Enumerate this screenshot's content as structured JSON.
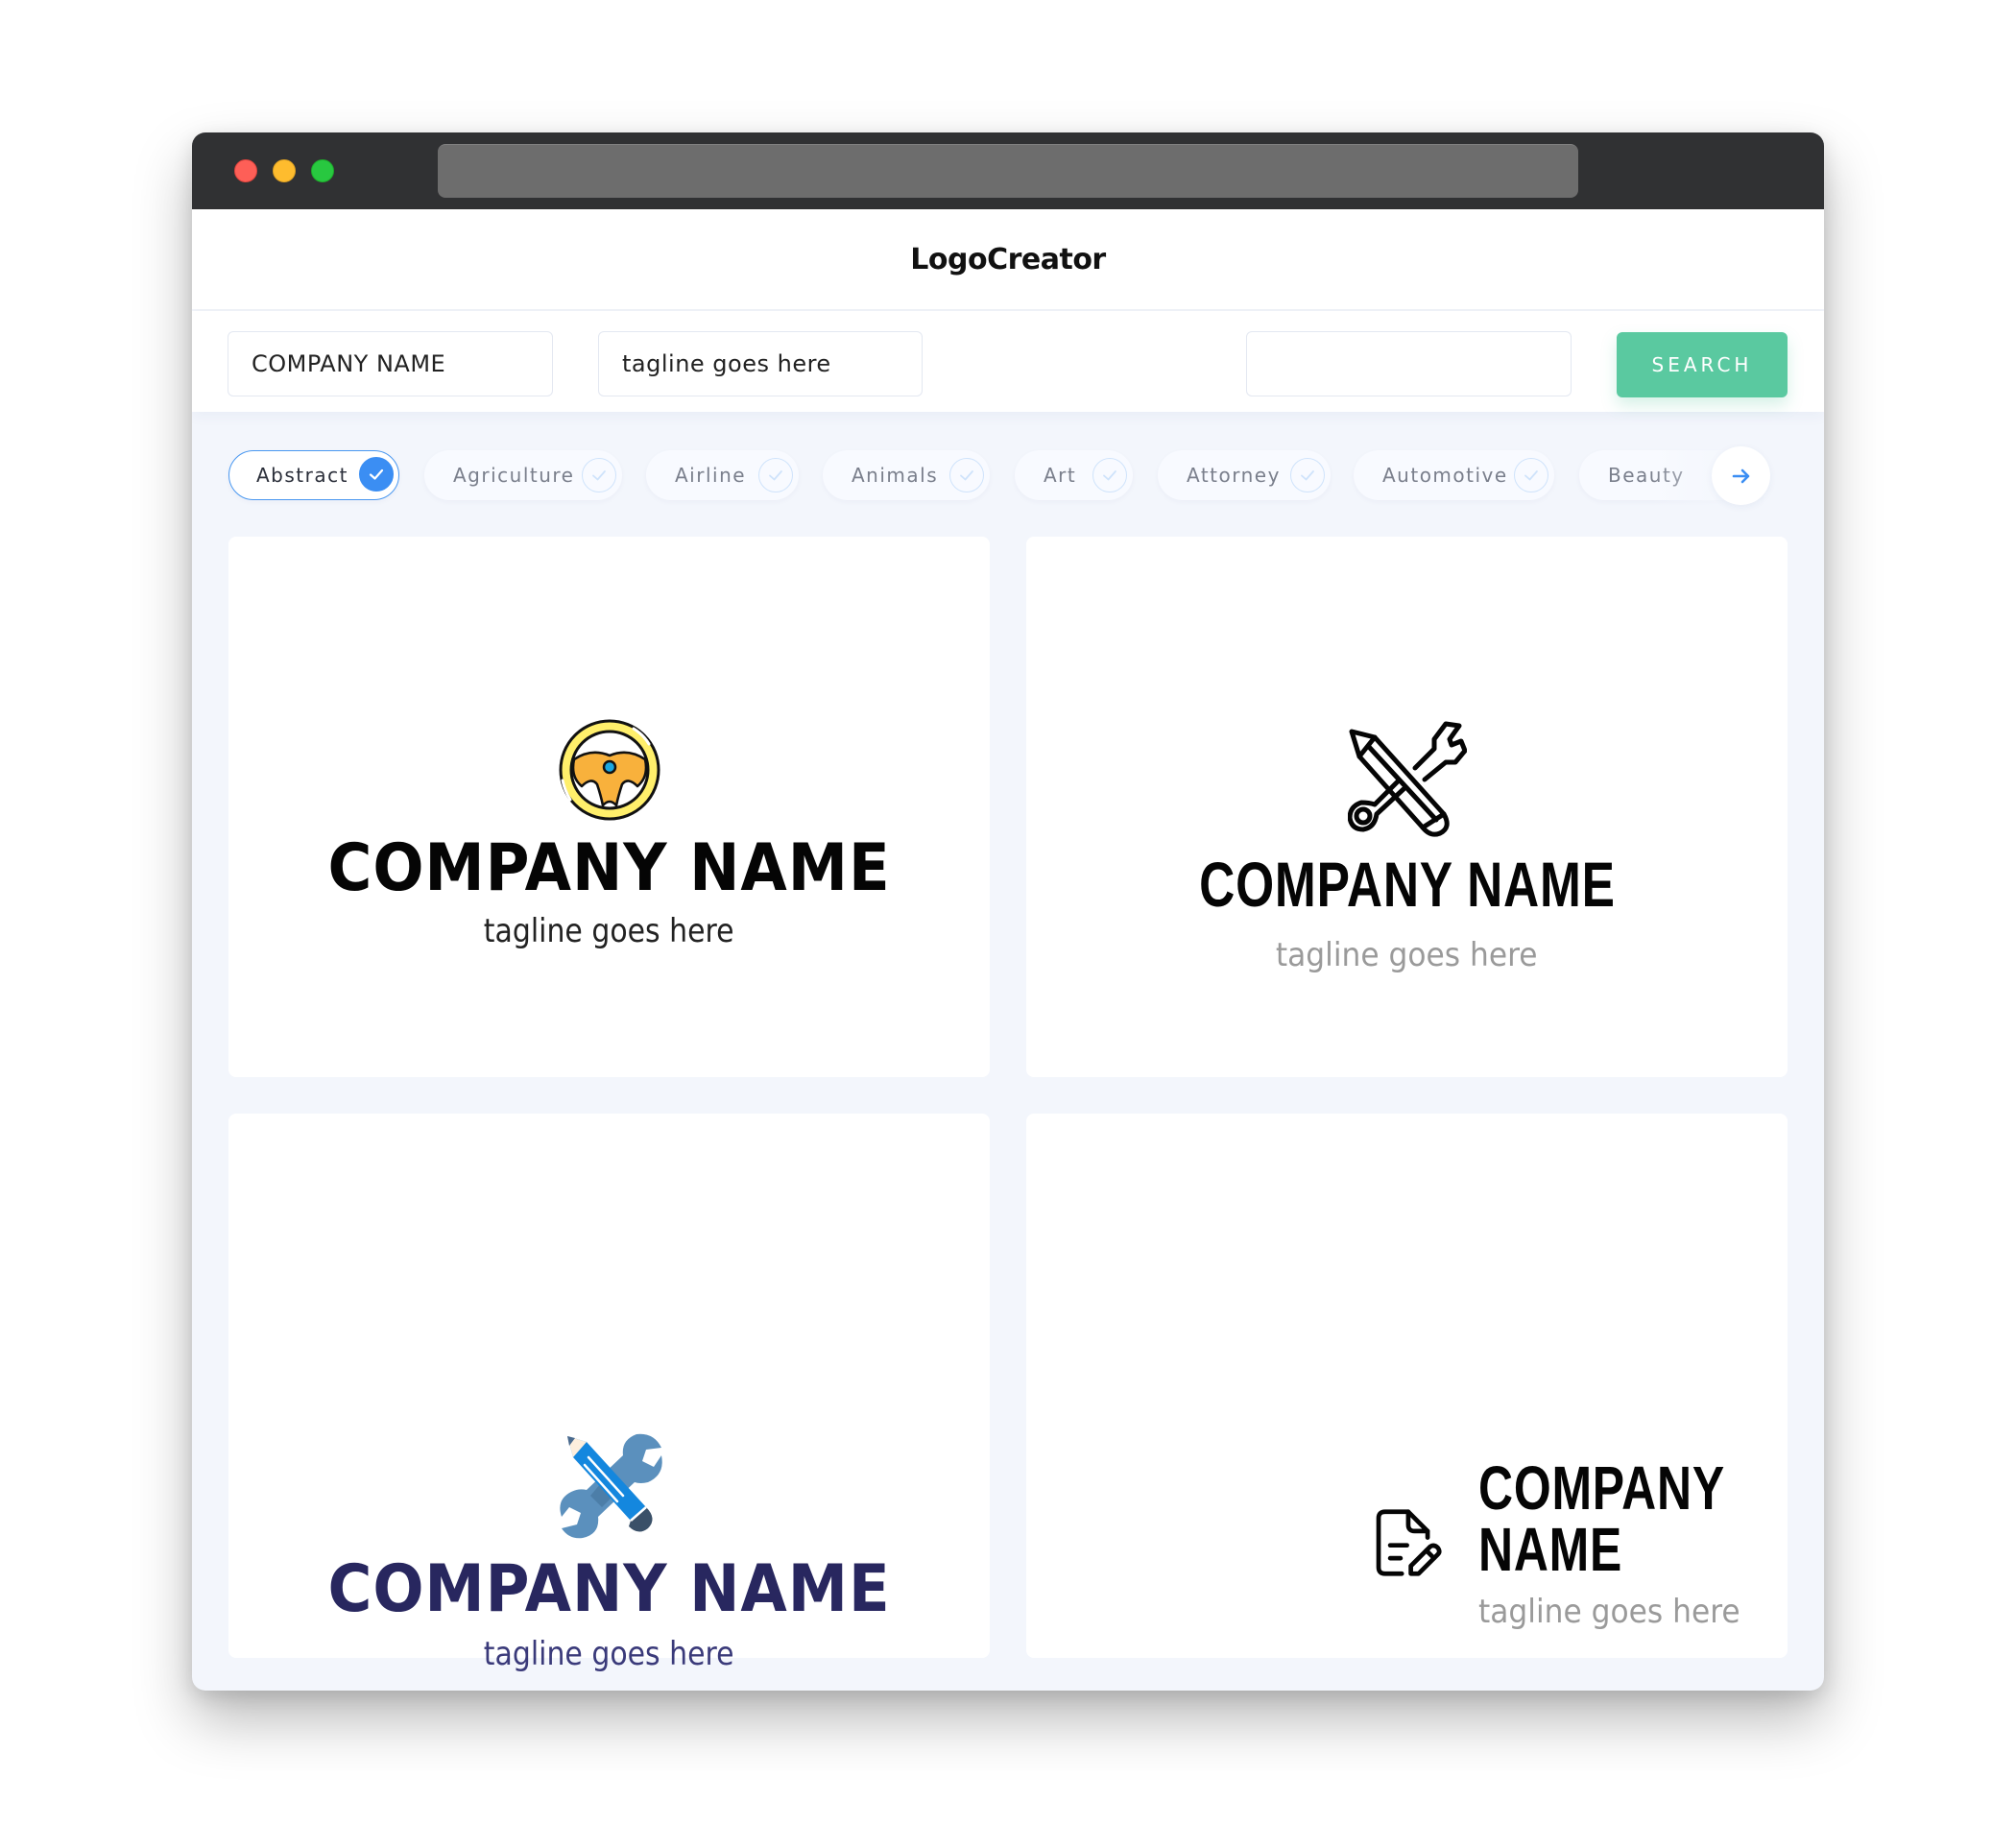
{
  "window": {
    "traffic_lights": [
      "close",
      "minimize",
      "maximize"
    ],
    "url": ""
  },
  "header": {
    "title": "LogoCreator"
  },
  "search": {
    "company_name_value": "COMPANY NAME",
    "tagline_value": "tagline goes here",
    "keyword_value": "",
    "button_label": "SEARCH",
    "button_color": "#5ac9a0"
  },
  "categories": {
    "items": [
      {
        "label": "Abstract",
        "selected": true
      },
      {
        "label": "Agriculture",
        "selected": false
      },
      {
        "label": "Airline",
        "selected": false
      },
      {
        "label": "Animals",
        "selected": false
      },
      {
        "label": "Art",
        "selected": false
      },
      {
        "label": "Attorney",
        "selected": false
      },
      {
        "label": "Automotive",
        "selected": false
      },
      {
        "label": "Beauty",
        "selected": false
      }
    ],
    "next_icon": "arrow-right-icon",
    "accent_color": "#3b8ef3"
  },
  "logos": [
    {
      "icon": "steering-wheel-icon",
      "company_name": "COMPANY NAME",
      "tagline": "tagline goes here",
      "name_color": "#050505"
    },
    {
      "icon": "pencil-wrench-outline-icon",
      "company_name": "COMPANY NAME",
      "tagline": "tagline goes here",
      "name_color": "#050505"
    },
    {
      "icon": "pencil-wrench-color-icon",
      "company_name": "COMPANY NAME",
      "tagline": "tagline goes here",
      "name_color": "#28275f"
    },
    {
      "icon": "document-edit-icon",
      "company_name": "COMPANY NAME",
      "tagline": "tagline goes here",
      "name_color": "#050505"
    }
  ]
}
